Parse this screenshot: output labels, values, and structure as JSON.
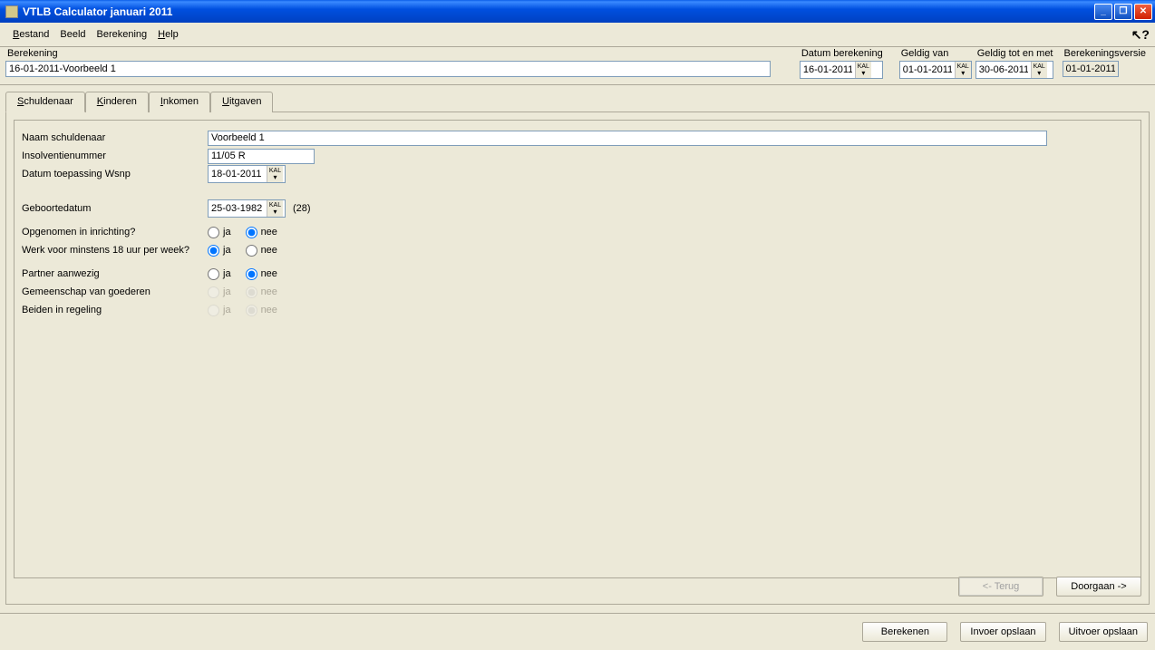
{
  "window": {
    "title": "VTLB Calculator januari 2011"
  },
  "menu": {
    "bestand": "Bestand",
    "beeld": "Beeld",
    "berekening": "Berekening",
    "help": "Help"
  },
  "header": {
    "berekening_label": "Berekening",
    "berekening_value": "16-01-2011-Voorbeeld 1",
    "datum_berekening_label": "Datum berekening",
    "datum_berekening_value": "16-01-2011",
    "geldig_van_label": "Geldig van",
    "geldig_van_value": "01-01-2011",
    "geldig_tot_label": "Geldig tot en met",
    "geldig_tot_value": "30-06-2011",
    "versie_label": "Berekeningsversie",
    "versie_value": "01-01-2011"
  },
  "tabs": {
    "schuldenaar": "Schuldenaar",
    "kinderen": "Kinderen",
    "inkomen": "Inkomen",
    "uitgaven": "Uitgaven"
  },
  "form": {
    "naam_label": "Naam schuldenaar",
    "naam_value": "Voorbeeld 1",
    "insolventie_label": "Insolventienummer",
    "insolventie_value": "11/05 R",
    "datum_wsnp_label": "Datum toepassing Wsnp",
    "datum_wsnp_value": "18-01-2011",
    "geboorte_label": "Geboortedatum",
    "geboorte_value": "25-03-1982",
    "age_note": "(28)",
    "opgenomen_label": "Opgenomen in inrichting?",
    "werk_label": "Werk voor minstens 18 uur per week?",
    "partner_label": "Partner aanwezig",
    "gemeenschap_label": "Gemeenschap van goederen",
    "beiden_label": "Beiden in regeling",
    "ja": "ja",
    "nee": "nee"
  },
  "nav": {
    "terug": "<- Terug",
    "doorgaan": "Doorgaan ->"
  },
  "bottom": {
    "berekenen": "Berekenen",
    "invoer": "Invoer opslaan",
    "uitvoer": "Uitvoer opslaan"
  }
}
